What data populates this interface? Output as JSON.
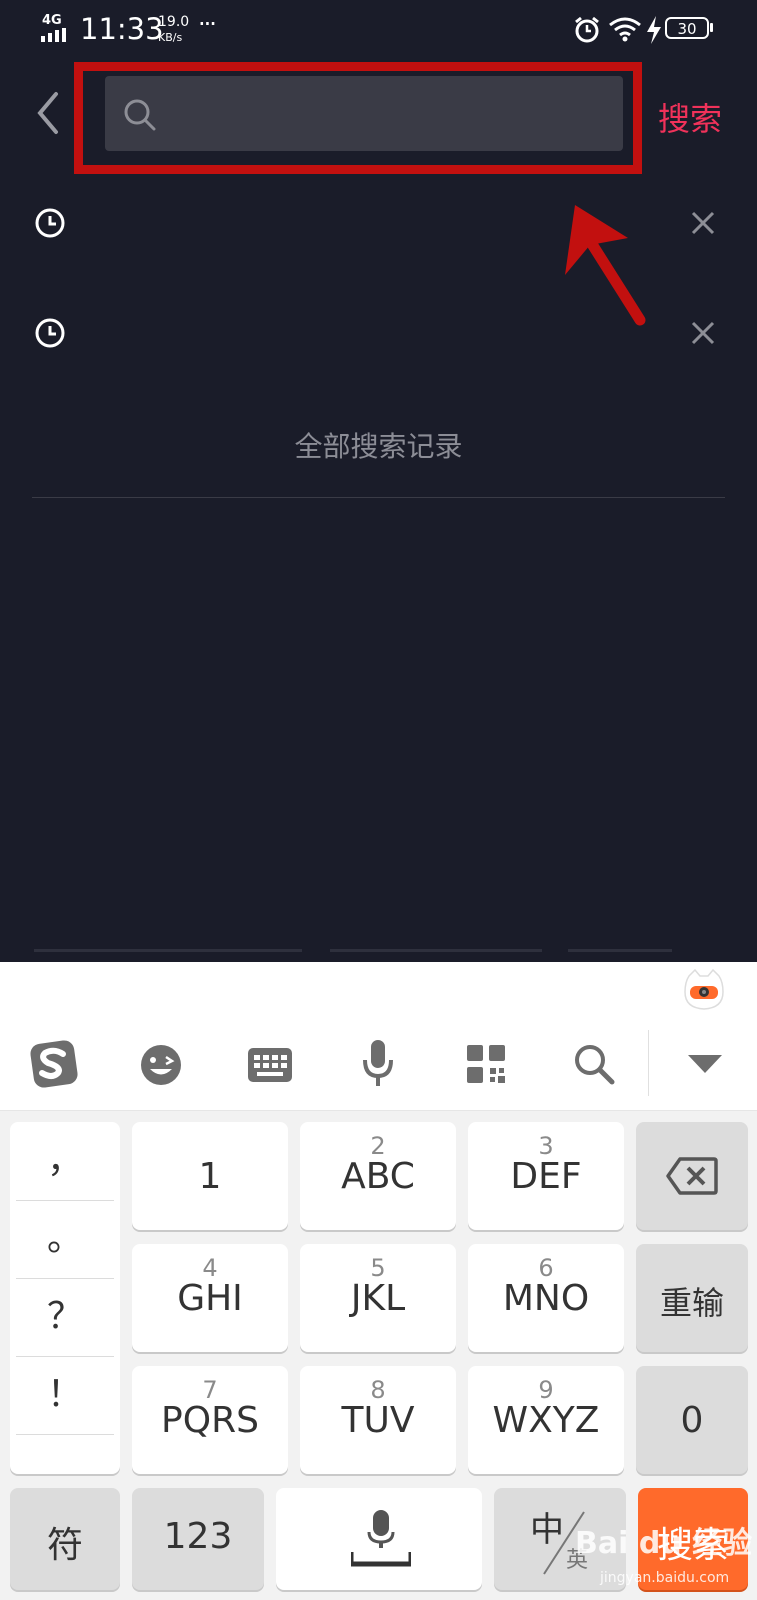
{
  "status_bar": {
    "network": "4G",
    "time": "11:33",
    "speed_value": "19.0",
    "speed_unit": "KB/s",
    "more": "···",
    "battery": "30"
  },
  "header": {
    "search_placeholder": "",
    "search_button": "搜索"
  },
  "history": {
    "items": [
      {
        "text": ""
      },
      {
        "text": ""
      }
    ],
    "all_records_label": "全部搜索记录"
  },
  "keyboard": {
    "toolbar_icons": [
      "sogou-logo-icon",
      "emoji-icon",
      "keyboard-icon",
      "microphone-icon",
      "grid-apps-icon",
      "search-icon",
      "collapse-down-icon"
    ],
    "punctuation": [
      "，",
      "。",
      "？",
      "！"
    ],
    "keys": [
      {
        "num": "",
        "main": "1"
      },
      {
        "num": "2",
        "main": "ABC"
      },
      {
        "num": "3",
        "main": "DEF"
      },
      {
        "num": "4",
        "main": "GHI"
      },
      {
        "num": "5",
        "main": "JKL"
      },
      {
        "num": "6",
        "main": "MNO"
      },
      {
        "num": "7",
        "main": "PQRS"
      },
      {
        "num": "8",
        "main": "TUV"
      },
      {
        "num": "9",
        "main": "WXYZ"
      }
    ],
    "reinput_label": "重输",
    "zero_label": "0",
    "symbol_label": "符",
    "num_label": "123",
    "lang_zh": "中",
    "lang_en": "英",
    "enter_label": "搜索"
  },
  "watermark": {
    "line1": "Bai du 经验",
    "line2": "jingyan.baidu.com"
  }
}
